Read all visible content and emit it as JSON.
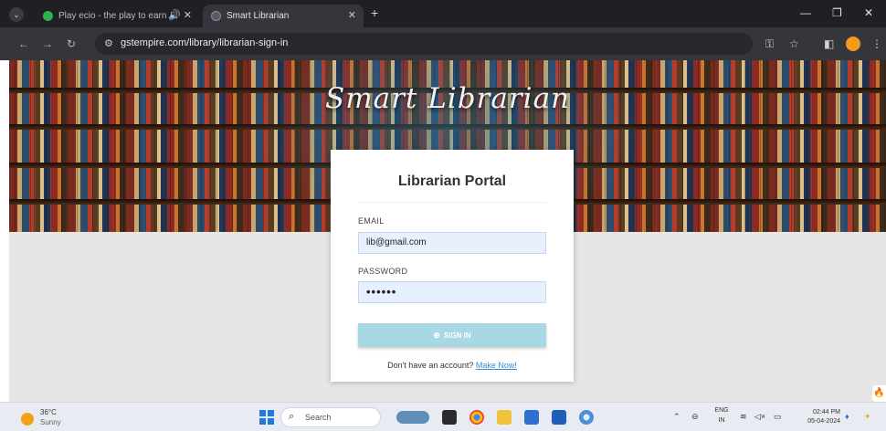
{
  "browser": {
    "tabs": [
      {
        "label": "Play ecio - the play to earn"
      },
      {
        "label": "Smart Librarian"
      }
    ],
    "url": "gstempire.com/library/librarian-sign-in",
    "controls": {
      "minimize": "—",
      "maximize": "ɑ",
      "close": "✕"
    }
  },
  "hero": {
    "title": "Smart Librarian"
  },
  "login": {
    "title": "Librarian Portal",
    "email_label": "EMAIL",
    "email_value": "lib@gmail.com",
    "password_label": "PASSWORD",
    "password_value": "••••••",
    "signin_label": "SIGN IN",
    "signup_prompt": "Don't have an account?",
    "signup_link": "Make Now!"
  },
  "taskbar": {
    "weather": {
      "temp": "36°C",
      "condition": "Sunny"
    },
    "search_placeholder": "Search",
    "language": {
      "lang": "ENG",
      "region": "IN"
    },
    "clock": {
      "time": "02:44 PM",
      "date": "05-04-2024"
    }
  },
  "colors": {
    "chrome_dark": "#1f1f24",
    "address_bar": "#35353c",
    "signin_button": "#a8d8e3",
    "link": "#2e8bd6",
    "field_fill": "#e8f0fe"
  }
}
